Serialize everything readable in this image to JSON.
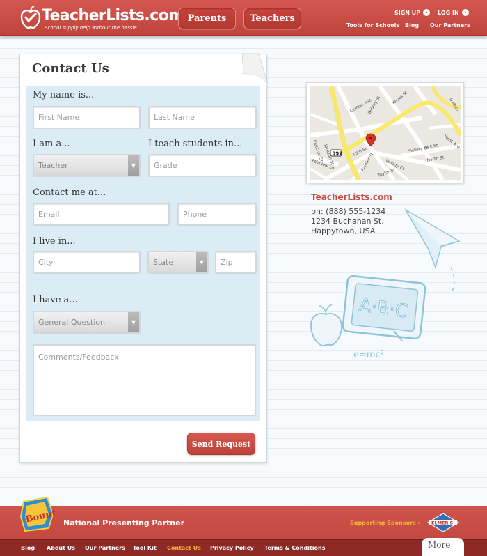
{
  "header": {
    "logo_text": "TeacherLists.com",
    "tagline": "School supply help without the hassle",
    "nav": [
      "Parents",
      "Teachers"
    ],
    "signup": "SIGN UP",
    "login": "LOG IN",
    "links": [
      "Tools for Schools",
      "Blog",
      "Our Partners"
    ],
    "arrow": "›"
  },
  "form": {
    "title": "Contact Us",
    "labels": {
      "name": "My name is...",
      "role": "I am a...",
      "teach": "I teach students in...",
      "contact": "Contact me at...",
      "live": "I live in...",
      "have": "I have a..."
    },
    "placeholders": {
      "first_name": "First Name",
      "last_name": "Last Name",
      "grade": "Grade",
      "email": "Email",
      "phone": "Phone",
      "city": "City",
      "zip": "Zip",
      "comments": "Comments/Feedback"
    },
    "selects": {
      "role": "Teacher",
      "state": "State",
      "inquiry": "General Question"
    },
    "send": "Send Request"
  },
  "contact": {
    "name": "TeacherLists.com",
    "phone": "ph: (888) 555-1234",
    "street": "1234 Buchanan St.",
    "city": "Happytown, USA"
  },
  "map": {
    "streets": [
      "Central Ave",
      "Bilbrey St",
      "Keyes St",
      "N Main",
      "West Ave",
      "10th St",
      "Woody Ct",
      "Hickory Ln",
      "Park St",
      "North St",
      "Fletcher St",
      "Jackson St",
      "Rainier St",
      "Taylor St",
      "Fairview Ln"
    ],
    "route": "392"
  },
  "doodles": {
    "chalkboard": "A·B·C",
    "formula": "e=mc²"
  },
  "footer": {
    "sponsor_logo": "Bounty",
    "partner": "National Presenting Partner",
    "sponsors": "Supporting Sponsors ›",
    "elmers": "ELMER'S",
    "links": [
      "Blog",
      "About Us",
      "Our Partners",
      "Tool Kit",
      "Contact Us",
      "Privacy Policy",
      "Terms & Conditions"
    ],
    "more": "More"
  },
  "colors": {
    "brand_red": "#c8473f",
    "accent_yellow": "#f3b23b",
    "panel_blue": "#dcecf5"
  }
}
